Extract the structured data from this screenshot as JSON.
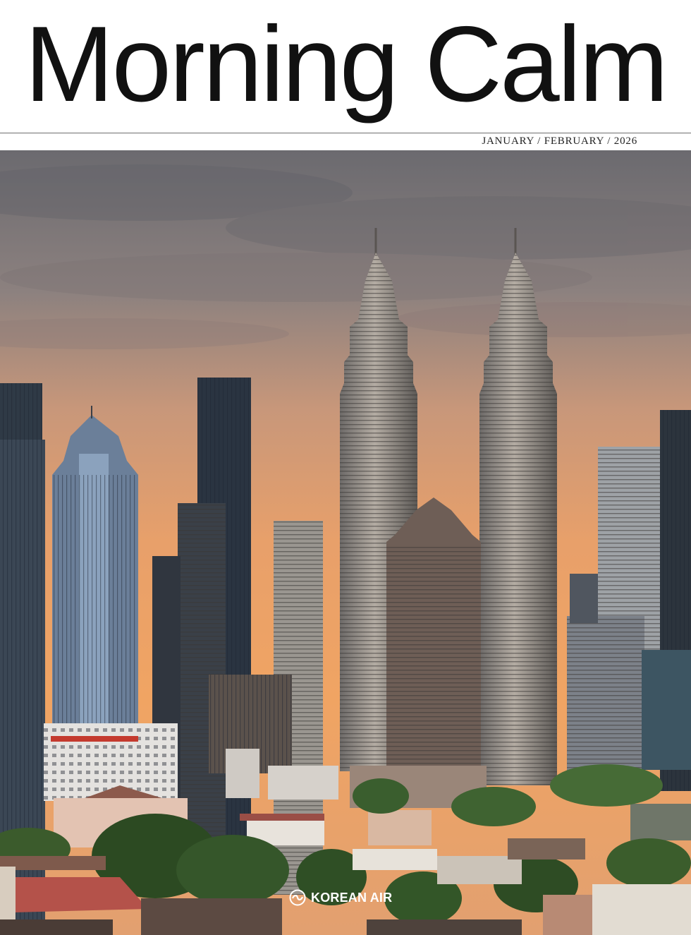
{
  "masthead": {
    "title": "Morning Calm",
    "issue_date": "JANUARY / FEBRUARY / 2026"
  },
  "cover": {
    "photo_subject": "city-skyline",
    "sky_colors": [
      "#6e6c70",
      "#a38f86",
      "#d99d70",
      "#ee9c5e"
    ]
  },
  "brand": {
    "name": "KOREAN AIR",
    "icon": "korean-air-logo-icon"
  }
}
